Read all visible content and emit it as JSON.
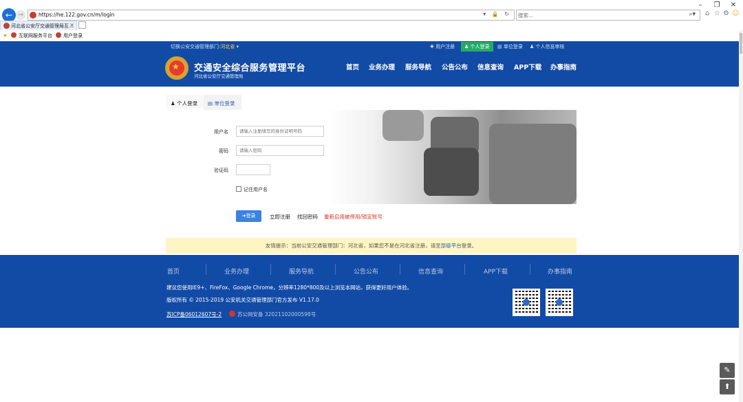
{
  "browser": {
    "url": "https://he.122.gov.cn/m/login",
    "search_placeholder": "搜索...",
    "tab_title": "河北省公安厅交通管理局互...",
    "favorites": [
      "互联网服务平台",
      "用户登录"
    ],
    "window_controls": [
      "–",
      "❐",
      "✕"
    ]
  },
  "topbar": {
    "dept_prefix": "切换公安交通管理部门:",
    "dept_value": "河北省",
    "links": [
      "用户注册",
      "个人登录",
      "单位登录",
      "个人信息审核"
    ]
  },
  "header": {
    "title": "交通安全综合服务管理平台",
    "subtitle": "河北省公安厅交通管理局",
    "nav": [
      "首页",
      "业务办理",
      "服务导航",
      "公告公布",
      "信息查询",
      "APP下载",
      "办事指南"
    ]
  },
  "login": {
    "tabs": [
      "个人登录",
      "单位登录"
    ],
    "username_label": "用户名",
    "username_placeholder": "请输入注册填写的身份证明号码",
    "password_label": "密码",
    "password_placeholder": "请输入密码",
    "captcha_label": "验证码",
    "remember_label": "记住用户名",
    "login_button": "登录",
    "register_link": "立即注册",
    "recover_link": "找回密码",
    "reactivate_link": "重新启用被停用/锁定账号"
  },
  "notice": {
    "prefix": "友情提示：当前公安交通管理部门：",
    "province": "河北省",
    "middle": "，如果您不是在河北省注册，请至",
    "link": "部级平台",
    "suffix": "登录。"
  },
  "footer": {
    "nav": [
      "首页",
      "业务办理",
      "服务导航",
      "公告公布",
      "信息查询",
      "APP下载",
      "办事指南"
    ],
    "browser_tip": "建议您使用IE9+、FireFox、Google Chrome，分辨率1280*800及以上浏览本网站，获得更好用户体验。",
    "copyright": "版权所有 © 2015-2019 公安机关交通管理部门官方发布 V1.17.0",
    "icp": "苏ICP备06012607号-2",
    "police": "苏公网安备 32021102000598号"
  },
  "colors": {
    "brand_blue": "#124ba6",
    "active_green": "#26a96c",
    "button_blue": "#3c82e3",
    "notice_bg": "#fdf6c4",
    "link_red": "#d8342a"
  }
}
